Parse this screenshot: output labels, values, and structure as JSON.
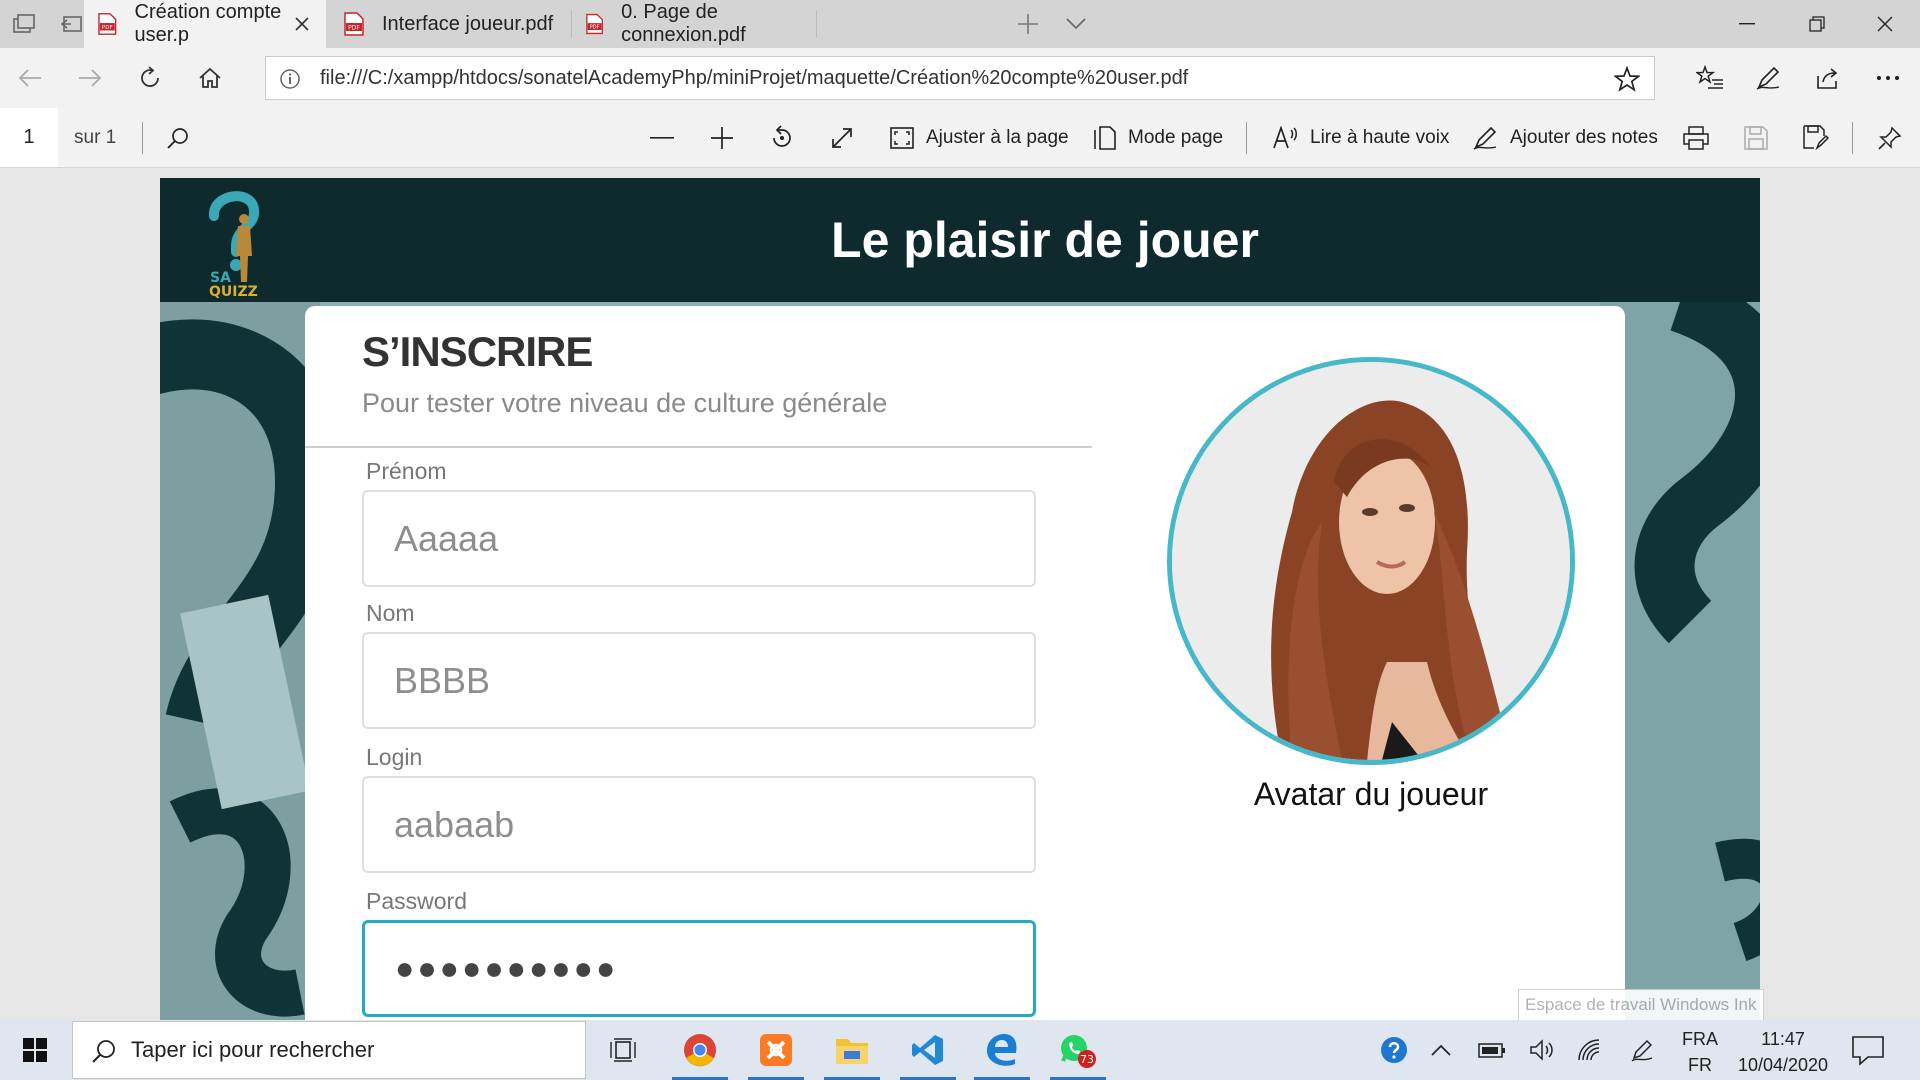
{
  "browser": {
    "tabs": [
      {
        "title": "Création compte user.p",
        "active": true
      },
      {
        "title": "Interface joueur.pdf",
        "active": false
      },
      {
        "title": "0. Page de connexion.pdf",
        "active": false
      }
    ],
    "url": "file:///C:/xampp/htdocs/sonatelAcademyPhp/miniProjet/maquette/Création%20compte%20user.pdf"
  },
  "pdf_toolbar": {
    "page_current": "1",
    "page_total": "sur 1",
    "fit_page": "Ajuster à la page",
    "page_mode": "Mode page",
    "read_aloud": "Lire à haute voix",
    "add_notes": "Ajouter des notes"
  },
  "document": {
    "header_title": "Le plaisir de jouer",
    "logo_text_top": "SA",
    "logo_text_bottom": "QUIZZ",
    "form": {
      "title": "S’INSCRIRE",
      "subtitle": "Pour tester votre niveau de culture générale",
      "fields": [
        {
          "label": "Prénom",
          "value": "Aaaaa"
        },
        {
          "label": "Nom",
          "value": "BBBB"
        },
        {
          "label": "Login",
          "value": "aabaab"
        },
        {
          "label": "Password",
          "value": "●●●●●●●●●●"
        }
      ]
    },
    "avatar_caption": "Avatar du joueur"
  },
  "ink_tooltip": "Espace de travail Windows Ink",
  "taskbar": {
    "search_placeholder": "Taper ici pour rechercher",
    "whatsapp_badge": "73",
    "lang_line1": "FRA",
    "lang_line2": "FR",
    "time": "11:47",
    "date": "10/04/2020"
  },
  "colors": {
    "header_bg": "#0e2a2d",
    "accent": "#28a8c4",
    "avatar_ring": "#46b8c9"
  }
}
